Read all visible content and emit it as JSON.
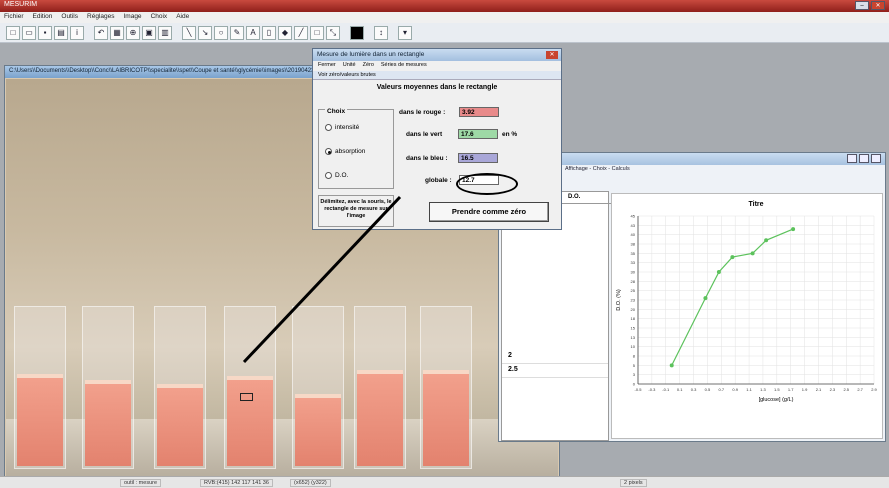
{
  "app": {
    "title": "MESURIM",
    "menu": [
      "Fichier",
      "Edition",
      "Outils",
      "Réglages",
      "Image",
      "Choix",
      "Aide"
    ],
    "status": [
      "outil : mesure",
      "RVB:(415) 142 117 141 36",
      "(x652) (y322)",
      "2 pixels"
    ]
  },
  "image_window": {
    "title": "C:\\Users\\\\Documents\\\\Desktop\\\\Conc\\\\LAIBRICOTP\\\\specialite\\\\spet\\\\Coupe et santé\\\\glycémie\\\\images\\\\20190423_111406.jpg"
  },
  "dialog": {
    "title": "Mesure de lumière dans un rectangle",
    "menu": [
      "Fermer",
      "Unité",
      "Zéro",
      "Séries de mesures"
    ],
    "menu2": "Voir zéro/valeurs brutes",
    "header": "Valeurs moyennes dans le rectangle",
    "choice_label": "Choix",
    "options": [
      "intensité",
      "absorption",
      "D.O."
    ],
    "selected_option": "absorption",
    "red_label": "dans le rouge :",
    "red_value": "3.92",
    "green_label": "dans le vert",
    "green_value": "17.6",
    "unit": "en %",
    "blue_label": "dans le bleu :",
    "blue_value": "16.5",
    "global_label": "globale :",
    "global_value": "12.7",
    "delimit_text": "Délimitez, avec la souris, le rectangle de mesure sur l'image",
    "zero_button": "Prendre comme zéro",
    "colors": {
      "red": "#e88a8a",
      "green": "#9ed9a6",
      "blue": "#a9a7d8"
    }
  },
  "chart_window": {
    "menu": "Affichage - Choix - Calculs",
    "table_header": "D.O.",
    "table_rows": [
      "2",
      "2.5"
    ]
  },
  "chart_data": {
    "type": "line",
    "title": "Titre",
    "xlabel": "[glucose] (g/L)",
    "ylabel": "D.O. (%)",
    "x": [
      0.0,
      0.5,
      0.7,
      0.9,
      1.2,
      1.4,
      1.8
    ],
    "y": [
      5.0,
      23.0,
      30.0,
      34.0,
      35.0,
      38.5,
      41.5
    ],
    "xlim": [
      -0.5,
      3.0
    ],
    "ylim": [
      0,
      45
    ],
    "xticks": [
      "-0.5",
      "-0.3",
      "-0.1",
      "0.1",
      "0.3",
      "0.5",
      "0.7",
      "0.9",
      "1.1",
      "1.3",
      "1.5",
      "1.7",
      "1.9",
      "2.1",
      "2.3",
      "2.5",
      "2.7",
      "2.9"
    ],
    "yticks": [
      "0",
      "3",
      "5",
      "8",
      "10",
      "13",
      "15",
      "18",
      "20",
      "23",
      "25",
      "28",
      "30",
      "33",
      "35",
      "38",
      "40",
      "43",
      "45"
    ],
    "grid": true,
    "color": "#5cc25c"
  }
}
